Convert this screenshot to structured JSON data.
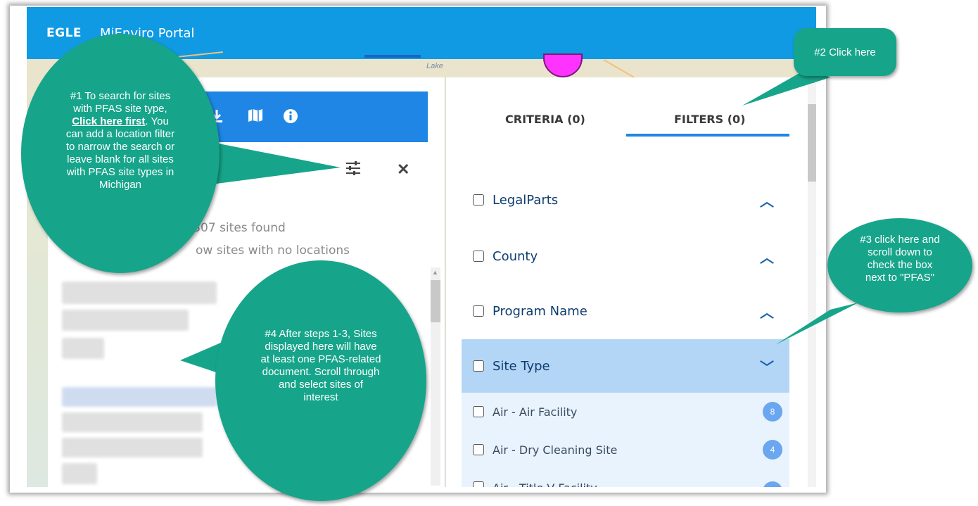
{
  "app": {
    "logo": "EGLE",
    "title": "MiEnviro Portal"
  },
  "map": {
    "label": "Lake"
  },
  "left_panel": {
    "toolbar_icons": [
      "download-icon",
      "map-icon",
      "info-icon"
    ],
    "results_count": "2,307 sites found",
    "no_locations_text": "ow sites with no locations"
  },
  "right_panel": {
    "tabs": [
      {
        "label": "CRITERIA (0)"
      },
      {
        "label": "FILTERS (0)"
      }
    ],
    "filters": [
      {
        "label": "LegalParts"
      },
      {
        "label": "County"
      },
      {
        "label": "Program Name"
      },
      {
        "label": "Site Type"
      }
    ],
    "site_types": [
      {
        "label": "Air - Air Facility",
        "count": "8"
      },
      {
        "label": "Air - Dry Cleaning Site",
        "count": "4"
      },
      {
        "label": "Air - Title V Facility",
        "count": ""
      }
    ]
  },
  "callouts": {
    "c1_line1": "#1 To search for sites",
    "c1_line2": "with PFAS site type,",
    "c1_bold": "Click here first",
    "c1_rest1": ". You",
    "c1_line4": "can add a location filter",
    "c1_line5": "to narrow the search or",
    "c1_line6": "leave blank for all sites",
    "c1_line7": "with PFAS site types in",
    "c1_line8": "Michigan",
    "c2": "#2 Click here",
    "c3_line1": "#3 click here and",
    "c3_line2": "scroll down to",
    "c3_line3": "check the box",
    "c3_line4": "next to \"PFAS\"",
    "c4_line1": "#4 After steps 1-3, Sites",
    "c4_line2": "displayed here will have",
    "c4_line3": "at least one PFAS-related",
    "c4_line4": "document.  Scroll through",
    "c4_line5": "and select sites of",
    "c4_line6": "interest"
  },
  "colors": {
    "header": "#0f9ae3",
    "toolbar": "#1f86e6",
    "callout": "#16a58a",
    "selected_row": "#b3d6f6"
  }
}
